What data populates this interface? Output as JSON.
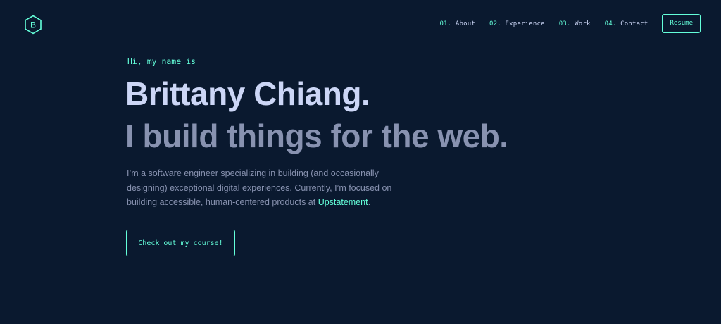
{
  "colors": {
    "background": "#0a192f",
    "accent": "#64ffda",
    "heading": "#ccd6f6",
    "text": "#8892b0"
  },
  "logo": {
    "letter": "B",
    "icon": "hexagon-logo-icon"
  },
  "nav": {
    "items": [
      {
        "num": "01.",
        "label": "About"
      },
      {
        "num": "02.",
        "label": "Experience"
      },
      {
        "num": "03.",
        "label": "Work"
      },
      {
        "num": "04.",
        "label": "Contact"
      }
    ],
    "resume_label": "Resume"
  },
  "hero": {
    "greeting": "Hi, my name is",
    "name": "Brittany Chiang.",
    "tagline": "I build things for the web.",
    "bio_before": "I’m a software engineer specializing in building (and occasionally designing) exceptional digital experiences. Currently, I’m focused on building accessible, human-centered products at ",
    "bio_link": "Upstatement",
    "bio_after": ".",
    "cta_label": "Check out my course!"
  }
}
